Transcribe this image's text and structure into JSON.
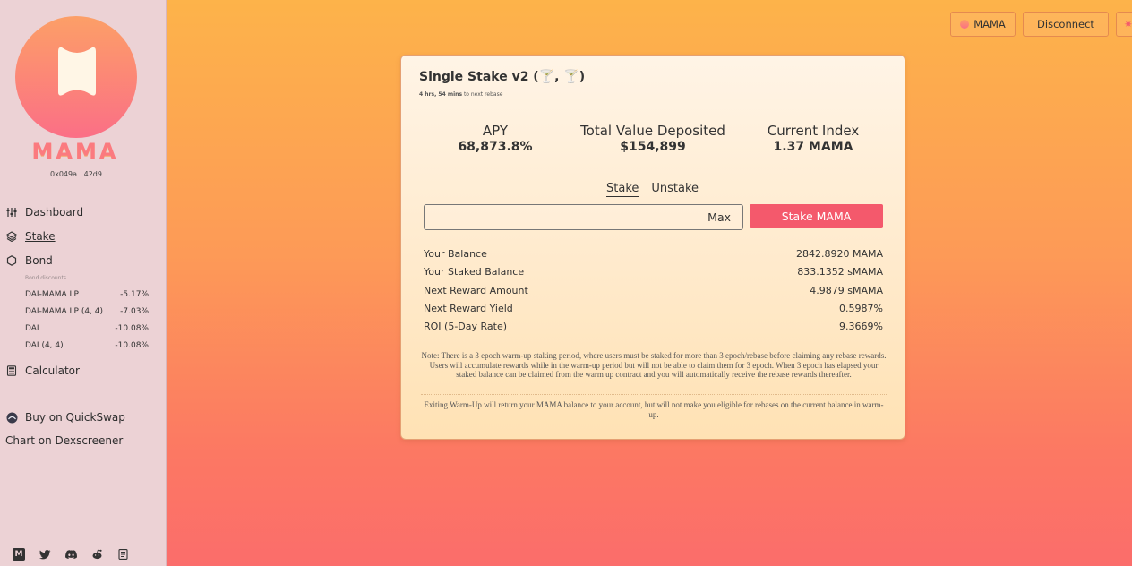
{
  "sidebar": {
    "wordmark": "MAMA",
    "address": "0x049a...42d9",
    "nav": {
      "dashboard": "Dashboard",
      "stake": "Stake",
      "bond": "Bond",
      "calculator": "Calculator",
      "buy": "Buy on QuickSwap",
      "chart": "Chart on Dexscreener"
    },
    "bond_discounts_label": "Bond discounts",
    "bonds": [
      {
        "name": "DAI-MAMA LP",
        "discount": "-5.17%"
      },
      {
        "name": "DAI-MAMA LP (4, 4)",
        "discount": "-7.03%"
      },
      {
        "name": "DAI",
        "discount": "-10.08%"
      },
      {
        "name": "DAI (4, 4)",
        "discount": "-10.08%"
      }
    ],
    "social_icons": [
      "medium-icon",
      "twitter-icon",
      "discord-icon",
      "reddit-icon",
      "docs-icon"
    ]
  },
  "header": {
    "token_label": "MAMA",
    "disconnect_label": "Disconnect"
  },
  "card": {
    "title": "Single Stake v2 (🍸, 🍸)",
    "rebase_time": "4 hrs, 54 mins",
    "rebase_suffix": " to next rebase",
    "stats": {
      "apy_label": "APY",
      "apy_value": "68,873.8%",
      "tvd_label": "Total Value Deposited",
      "tvd_value": "$154,899",
      "index_label": "Current Index",
      "index_value": "1.37 MAMA"
    },
    "tabs": {
      "stake": "Stake",
      "unstake": "Unstake"
    },
    "amount_value": "",
    "max_label": "Max",
    "stake_button": "Stake MAMA",
    "rows": [
      {
        "label": "Your Balance",
        "value": "2842.8920 MAMA"
      },
      {
        "label": "Your Staked Balance",
        "value": "833.1352 sMAMA"
      },
      {
        "label": "Next Reward Amount",
        "value": "4.9879 sMAMA"
      },
      {
        "label": "Next Reward Yield",
        "value": "0.5987%"
      },
      {
        "label": "ROI (5-Day Rate)",
        "value": "9.3669%"
      }
    ],
    "note1": "Note: There is a 3 epoch warm-up staking period, where users must be staked for more than 3 epoch/rebase before claiming any rebase rewards. Users will accumulate rewards while in the warm-up period but will not be able to claim them for 3 epoch. When 3 epoch has elapsed your staked balance can be claimed from the warm up contract and you will automatically receive the rebase rewards thereafter.",
    "note2": "Exiting Warm-Up will return your MAMA balance to your account, but will not make you eligible for rebases on the current balance in warm-up."
  },
  "colors": {
    "accent": "#f4596c",
    "sidebar_bg": "#ecd2d5",
    "gradient_top": "#fdb34a",
    "gradient_bottom": "#fb6d6b"
  }
}
